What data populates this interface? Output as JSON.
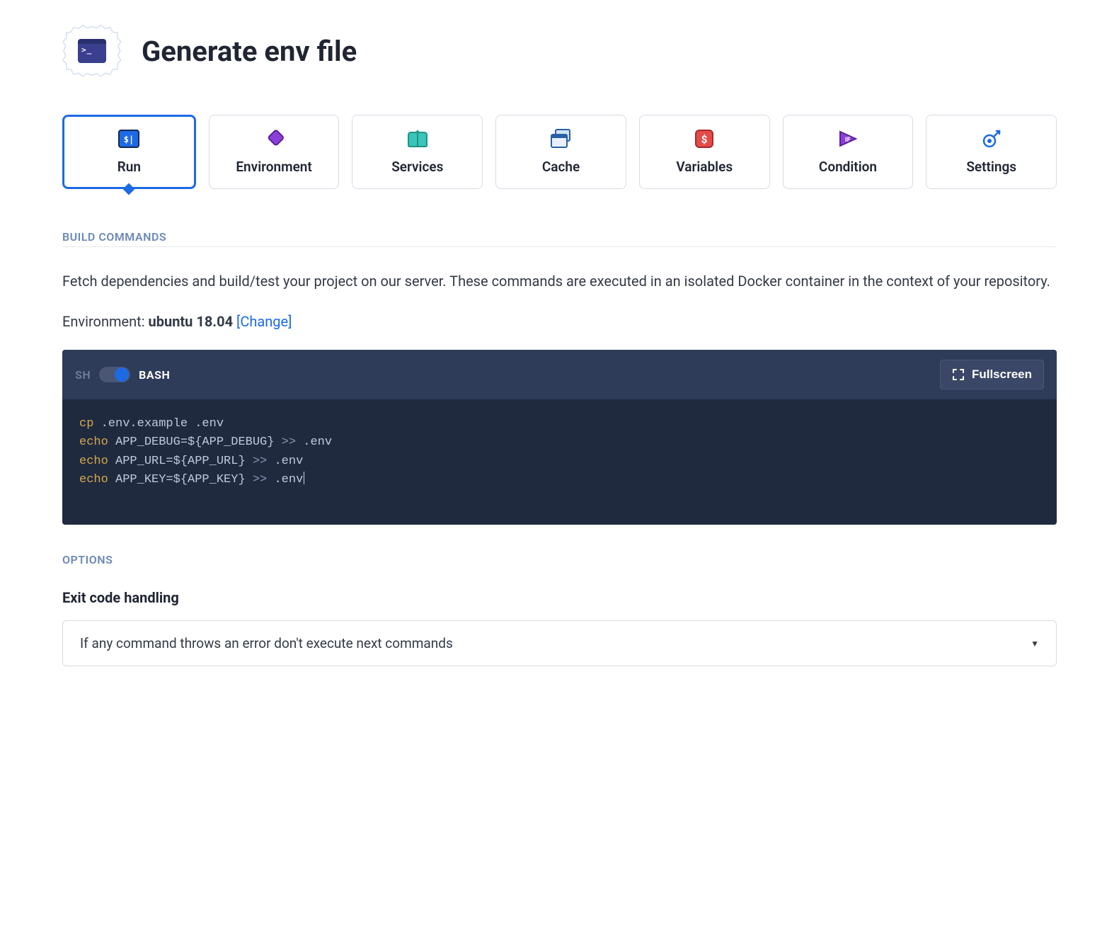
{
  "header": {
    "title": "Generate env file"
  },
  "tabs": [
    {
      "id": "run",
      "label": "Run",
      "active": true
    },
    {
      "id": "environment",
      "label": "Environment",
      "active": false
    },
    {
      "id": "services",
      "label": "Services",
      "active": false
    },
    {
      "id": "cache",
      "label": "Cache",
      "active": false
    },
    {
      "id": "variables",
      "label": "Variables",
      "active": false
    },
    {
      "id": "condition",
      "label": "Condition",
      "active": false
    },
    {
      "id": "settings",
      "label": "Settings",
      "active": false
    }
  ],
  "build": {
    "heading": "BUILD COMMANDS",
    "description": "Fetch dependencies and build/test your project on our server. These commands are executed in an isolated Docker container in the context of your repository.",
    "env_label": "Environment: ",
    "env_value": "ubuntu 18.04",
    "change_label": "[Change]"
  },
  "shell": {
    "sh_label": "SH",
    "bash_label": "BASH",
    "mode": "bash",
    "fullscreen_label": "Fullscreen"
  },
  "code": {
    "lines": [
      {
        "cmd": "cp",
        "args": ".env.example .env"
      },
      {
        "cmd": "echo",
        "args": "APP_DEBUG=${APP_DEBUG}",
        "op": ">>",
        "target": ".env"
      },
      {
        "cmd": "echo",
        "args": "APP_URL=${APP_URL}",
        "op": ">>",
        "target": ".env"
      },
      {
        "cmd": "echo",
        "args": "APP_KEY=${APP_KEY}",
        "op": ">>",
        "target": ".env"
      }
    ]
  },
  "options": {
    "heading": "OPTIONS",
    "exit_code_label": "Exit code handling",
    "exit_code_value": "If any command throws an error don't execute next commands"
  }
}
